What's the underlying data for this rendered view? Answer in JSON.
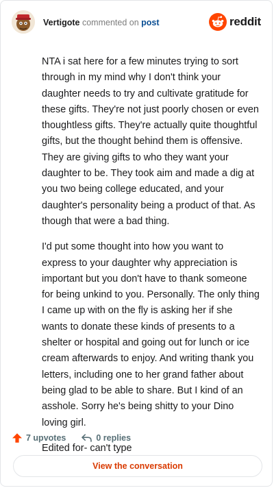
{
  "header": {
    "username": "Vertigote",
    "action_text": "commented on",
    "target": "post",
    "brand": "reddit"
  },
  "comment": {
    "paragraphs": [
      "NTA i sat here for a few minutes trying to sort through in my mind why I don't think your daughter needs to try and cultivate gratitude for these gifts. They're not just poorly chosen or even thoughtless gifts. They're actually quite thoughtful gifts, but the thought behind them is offensive. They are giving gifts to who they want your daughter to be. They took aim and made a dig at you two being college educated, and your daughter's personality being a product of that. As though that were a bad thing.",
      "I'd put some thought into how you want to express to your daughter why appreciation is important but you don't have to thank someone for being unkind to you. Personally. The only thing I came up with on the fly is asking her if she wants to donate these kinds of presents to a shelter or hospital and going out for lunch or ice cream afterwards to enjoy. And writing thank you letters, including one to her grand father about being glad to be able to share. But I kind of an asshole. Sorry he's being shitty to your Dino loving girl.",
      "Edited for- can't type"
    ]
  },
  "actions": {
    "upvotes": "7 upvotes",
    "replies": "0 replies"
  },
  "cta": {
    "label": "View the conversation"
  },
  "colors": {
    "brand_orange": "#ff4500",
    "link_blue": "#0a4e93",
    "cta_text": "#d93a00"
  }
}
